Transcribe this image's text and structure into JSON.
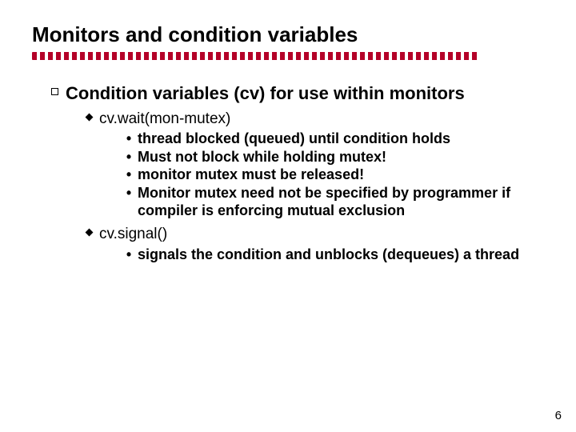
{
  "title": "Monitors and condition variables",
  "lvl1": {
    "text": "Condition variables (cv) for use within monitors"
  },
  "wait": {
    "label": "cv.wait(mon-mutex)",
    "items": [
      "thread blocked (queued) until condition holds",
      "Must not block while holding mutex!",
      "monitor mutex must be released!",
      "Monitor mutex need not be specified by programmer if compiler is enforcing mutual exclusion"
    ]
  },
  "signal": {
    "label": "cv.signal()",
    "items": [
      "signals the condition and unblocks (dequeues) a thread"
    ]
  },
  "page_number": "6"
}
